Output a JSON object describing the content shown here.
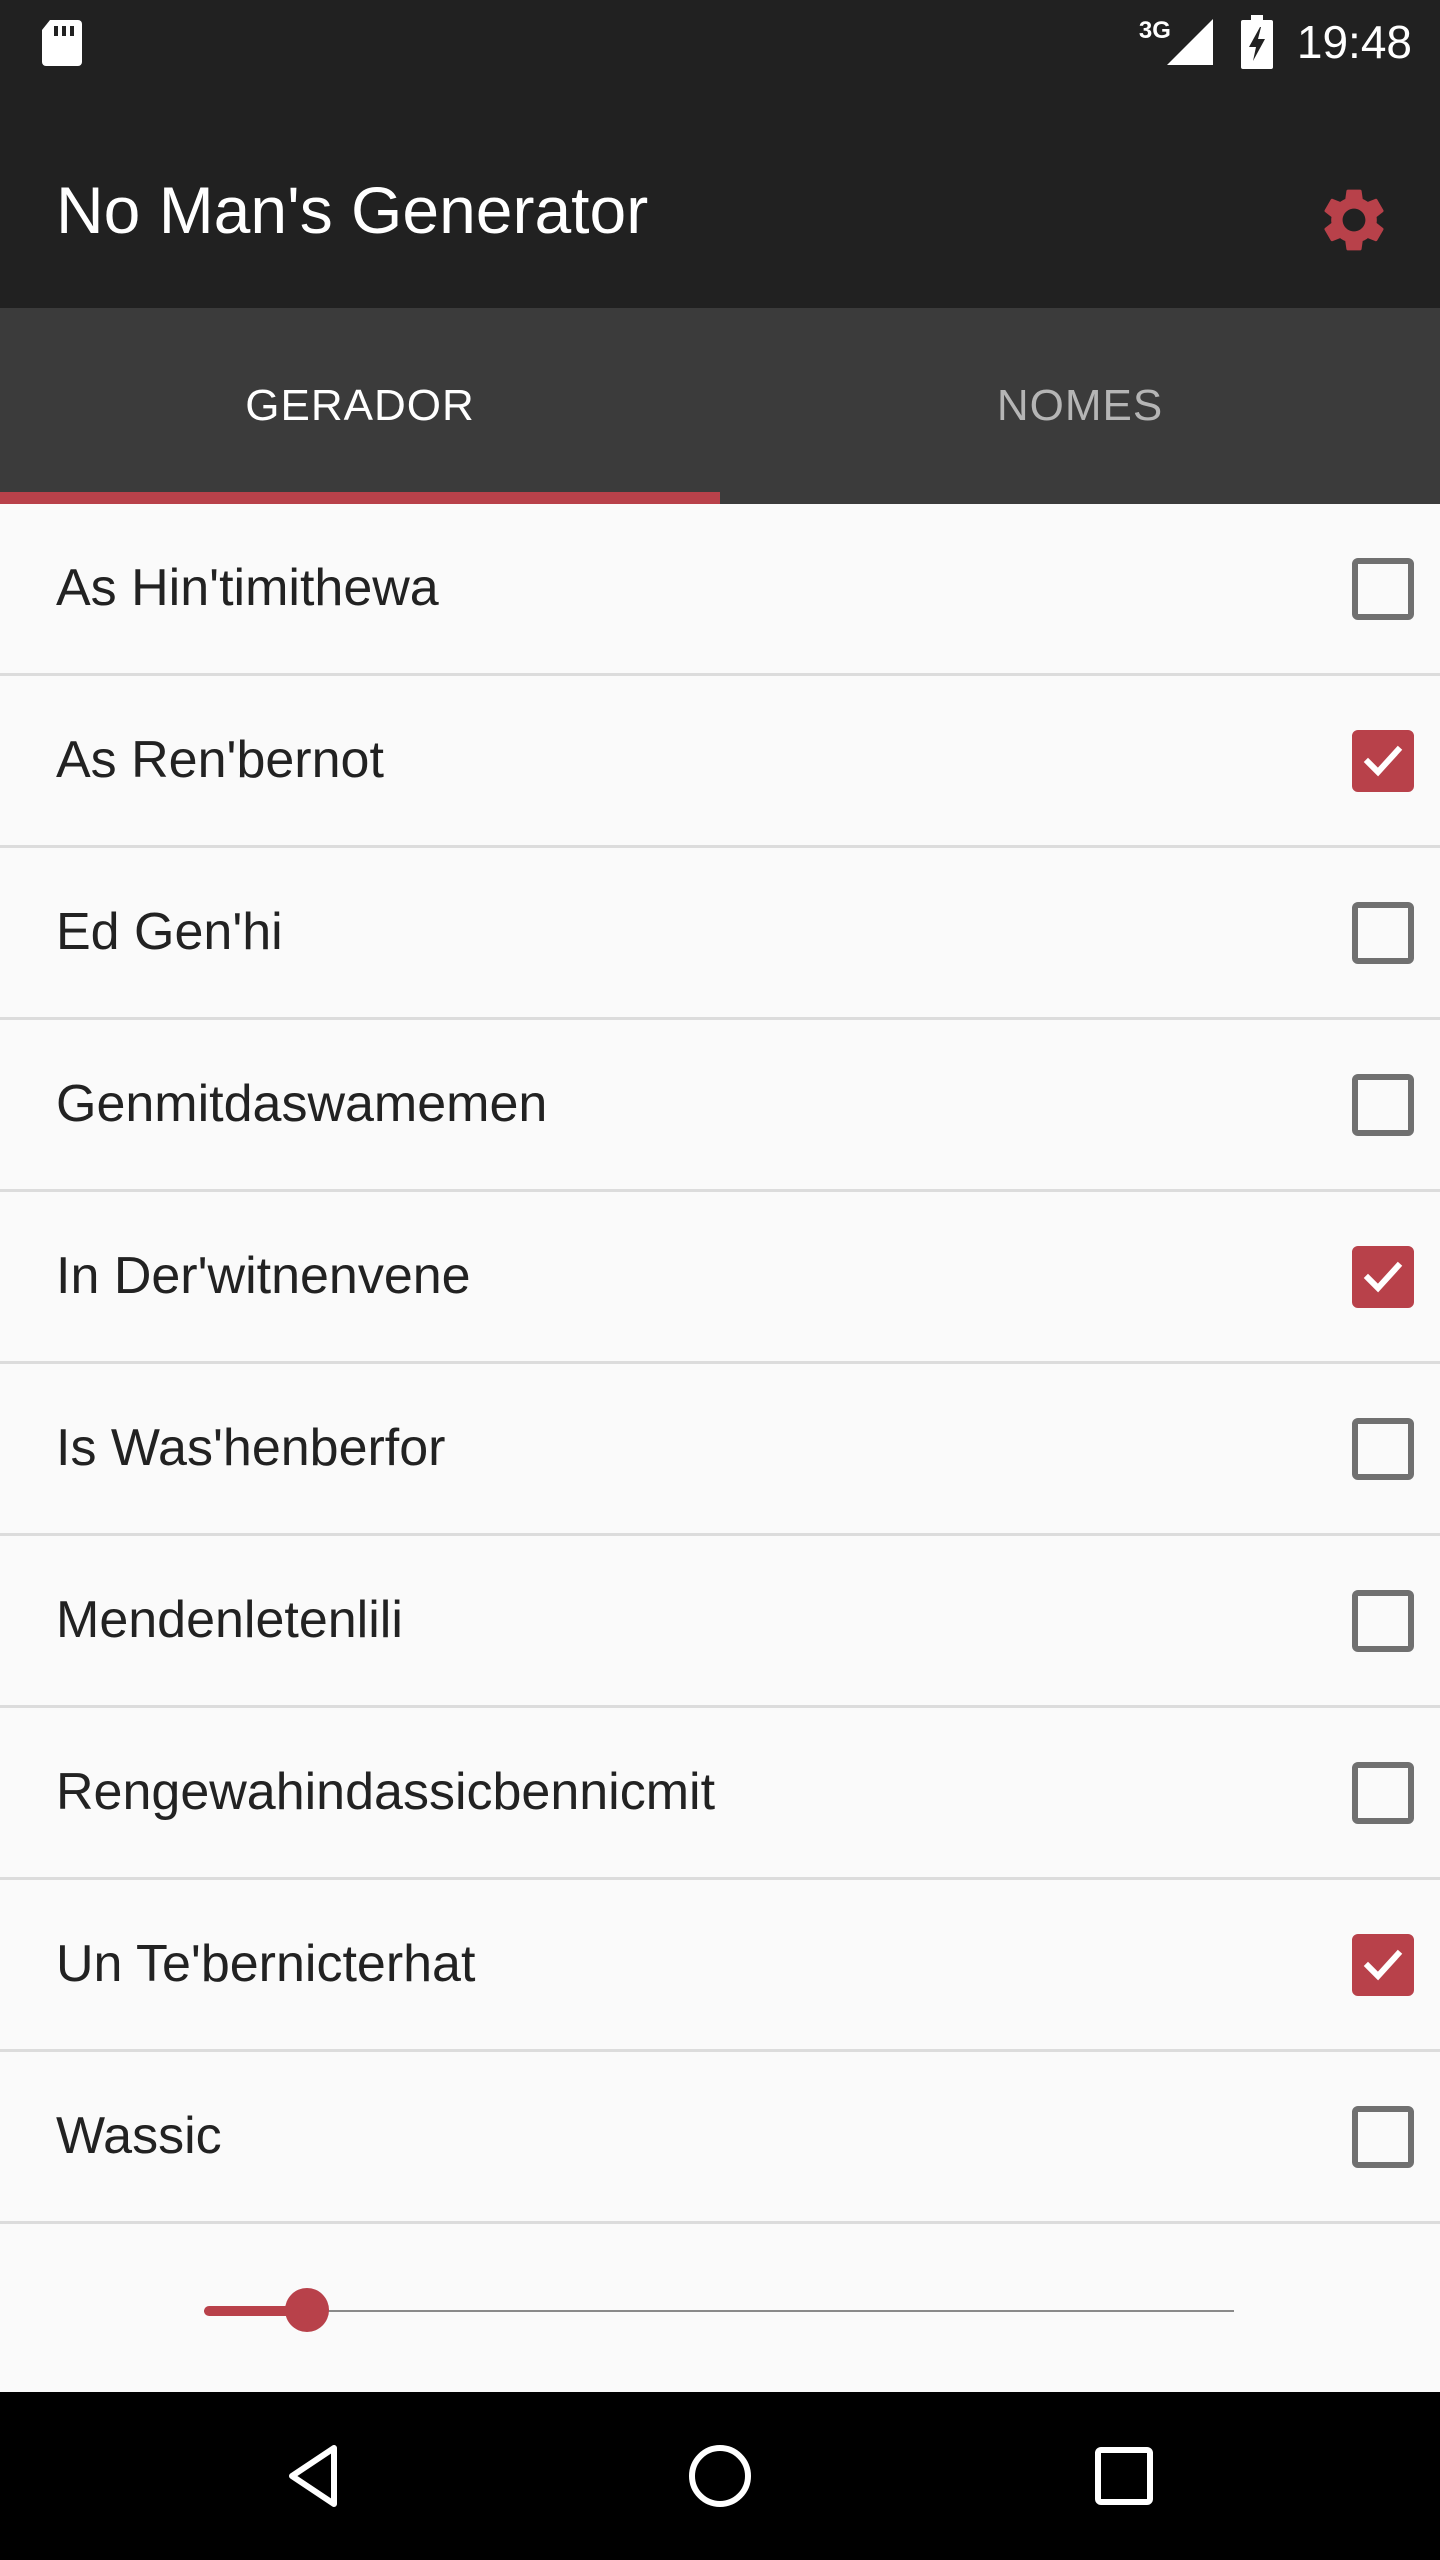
{
  "status_bar": {
    "network_type": "3G",
    "time": "19:48"
  },
  "app": {
    "title": "No Man's Generator",
    "accent_color": "#b8414a"
  },
  "tabs": [
    {
      "label": "GERADOR",
      "active": true
    },
    {
      "label": "NOMES",
      "active": false
    }
  ],
  "names": [
    {
      "label": "As Hin'timithewa",
      "checked": false
    },
    {
      "label": "As Ren'bernot",
      "checked": true
    },
    {
      "label": "Ed Gen'hi",
      "checked": false
    },
    {
      "label": "Genmitdaswamemen",
      "checked": false
    },
    {
      "label": "In Der'witnenvene",
      "checked": true
    },
    {
      "label": "Is Was'henberfor",
      "checked": false
    },
    {
      "label": "Mendenletenlili",
      "checked": false
    },
    {
      "label": "Rengewahindassicbennicmit",
      "checked": false
    },
    {
      "label": "Un Te'bernicterhat",
      "checked": true
    },
    {
      "label": "Wassic",
      "checked": false
    }
  ],
  "slider": {
    "value_fraction": 0.1
  },
  "icons": {
    "settings": "gear-icon",
    "sd_card": "sd-card-icon",
    "signal": "signal-icon",
    "battery": "battery-charging-icon",
    "nav_back": "back-triangle-icon",
    "nav_home": "home-circle-icon",
    "nav_recents": "recents-square-icon"
  }
}
